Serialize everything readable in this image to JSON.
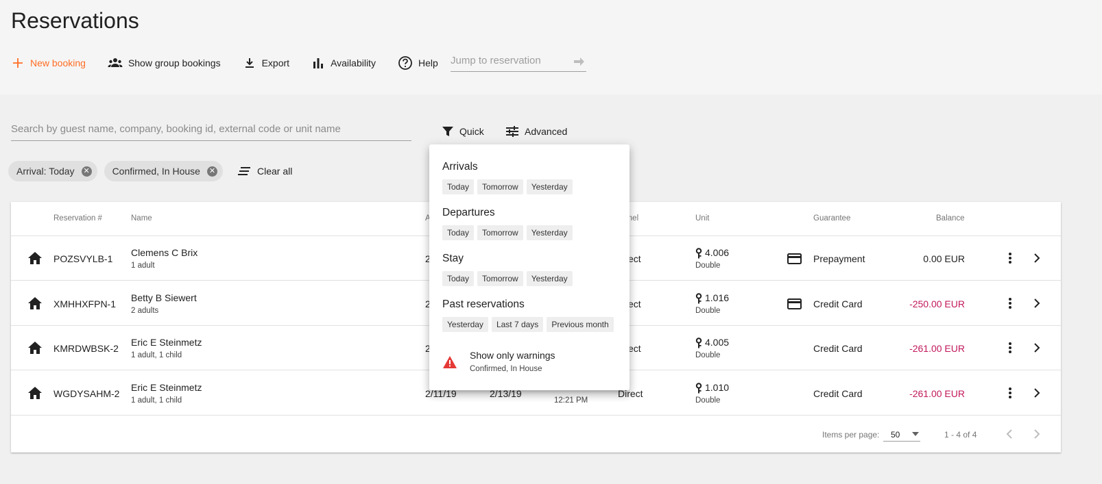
{
  "page": {
    "title": "Reservations"
  },
  "toolbar": {
    "new_booking": "New booking",
    "group_bookings": "Show group bookings",
    "export": "Export",
    "availability": "Availability",
    "help": "Help",
    "jump_placeholder": "Jump to reservation"
  },
  "search": {
    "placeholder": "Search by guest name, company, booking id, external code or unit name"
  },
  "filters": {
    "quick": "Quick",
    "advanced": "Advanced"
  },
  "chips": [
    "Arrival: Today",
    "Confirmed, In House"
  ],
  "clear_all": "Clear all",
  "table": {
    "headers": {
      "reservation": "Reservation #",
      "name": "Name",
      "arrival": "A",
      "channel": "annel",
      "unit": "Unit",
      "guarantee": "Guarantee",
      "balance": "Balance"
    },
    "rows": [
      {
        "res": "POZSVYLB-1",
        "name": "Clemens C Brix",
        "guests": "1  adult",
        "arrival": "2",
        "channel": "ect",
        "unit": "4.006",
        "unit_type": "Double",
        "guarantee": "Prepayment",
        "balance": "0.00 EUR",
        "negative": false,
        "card": true
      },
      {
        "res": "XMHHXFPN-1",
        "name": "Betty B Siewert",
        "guests": "2  adults",
        "arrival": "2",
        "channel": "ect",
        "unit": "1.016",
        "unit_type": "Double",
        "guarantee": "Credit Card",
        "balance": "-250.00 EUR",
        "negative": true,
        "card": true
      },
      {
        "res": "KMRDWBSK-2",
        "name": "Eric E Steinmetz",
        "guests": "1  adult,  1  child",
        "arrival": "2",
        "channel": "ect",
        "unit": "4.005",
        "unit_type": "Double",
        "guarantee": "Credit Card",
        "balance": "-261.00 EUR",
        "negative": true,
        "card": false
      },
      {
        "res": "WGDYSAHM-2",
        "name": "Eric E Steinmetz",
        "guests": "1  adult,  1  child",
        "arrival": "2/11/19",
        "departure": "2/13/19",
        "time": "12:21 PM",
        "channel": "Direct",
        "unit": "1.010",
        "unit_type": "Double",
        "guarantee": "Credit Card",
        "balance": "-261.00 EUR",
        "negative": true,
        "card": false
      }
    ]
  },
  "pagination": {
    "items_per_page_label": "Items per page:",
    "page_size": "50",
    "range": "1 - 4 of 4"
  },
  "quick_menu": {
    "sections": [
      {
        "title": "Arrivals",
        "options": [
          "Today",
          "Tomorrow",
          "Yesterday"
        ]
      },
      {
        "title": "Departures",
        "options": [
          "Today",
          "Tomorrow",
          "Yesterday"
        ]
      },
      {
        "title": "Stay",
        "options": [
          "Today",
          "Tomorrow",
          "Yesterday"
        ]
      },
      {
        "title": "Past reservations",
        "options": [
          "Yesterday",
          "Last 7 days",
          "Previous month"
        ]
      }
    ],
    "warnings": {
      "title": "Show only warnings",
      "subtitle": "Confirmed, In House"
    }
  },
  "colors": {
    "accent": "#ff6d24",
    "negative": "#c2185b",
    "warning": "#e53935"
  }
}
